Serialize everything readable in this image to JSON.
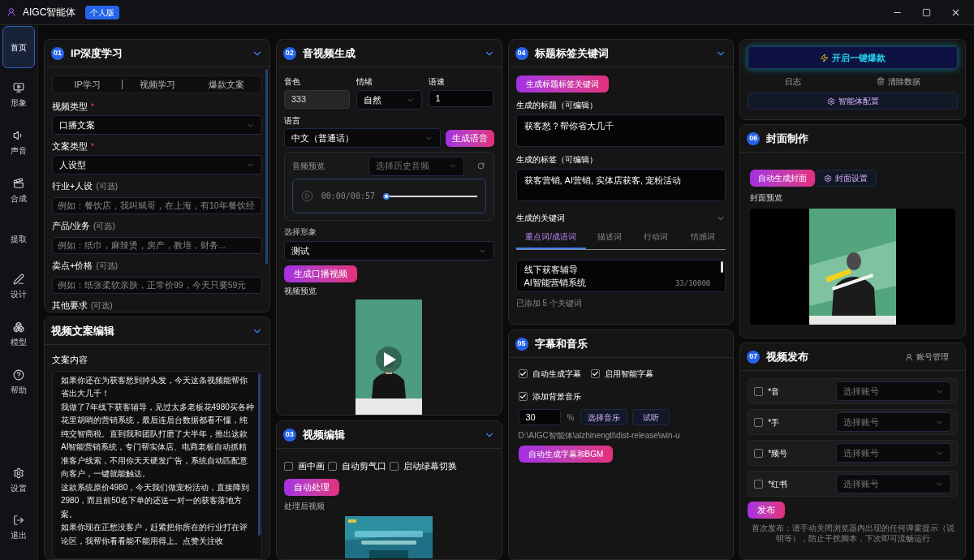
{
  "app": {
    "title": "AIGC智能体",
    "badge": "个人版"
  },
  "sidebar": {
    "items": [
      {
        "label": "首页",
        "selected": true
      },
      {
        "label": "形象",
        "selected": false
      },
      {
        "label": "声音",
        "selected": false
      },
      {
        "label": "合成",
        "selected": false
      },
      {
        "label": "提取",
        "selected": false
      },
      {
        "label": "设计",
        "selected": false
      },
      {
        "label": "模型",
        "selected": false
      },
      {
        "label": "帮助",
        "selected": false
      }
    ],
    "bottom_items": [
      {
        "label": "设置"
      },
      {
        "label": "退出"
      }
    ]
  },
  "ip_learning": {
    "number": "01",
    "title": "IP深度学习",
    "tabs": [
      "IP学习",
      "视频学习",
      "爆款文案"
    ],
    "fields": [
      {
        "label": "视频类型",
        "required_mark": "*",
        "kind": "select",
        "value": "口播文案"
      },
      {
        "label": "文案类型",
        "required_mark": "*",
        "kind": "select",
        "value": "人设型"
      },
      {
        "label": "行业+人设",
        "optional": "(可选)",
        "kind": "input",
        "placeholder": "例如：餐饮店，我叫斌哥，在上海，有10年餐饮经"
      },
      {
        "label": "产品/业务",
        "optional": "(可选)",
        "kind": "input",
        "placeholder": "例如：纸巾，麻辣烫，房产，教培，财务..."
      },
      {
        "label": "卖点+价格",
        "optional": "(可选)",
        "kind": "input",
        "placeholder": "例如：纸张柔软亲肤，正常价99，今天只要59元"
      },
      {
        "label": "其他要求",
        "optional": "(可选)",
        "kind": "label"
      }
    ]
  },
  "script_editor": {
    "title": "视频文案编辑",
    "label": "文案内容",
    "paragraphs": [
      "如果你还在为获客愁到掉头发，今天这条视频能帮你省出大几千！",
      "我做了7年线下获客辅导，见过太多老板花4980买各种花里胡哨的营销系统，最后连后台数据都看不懂，纯纯交智商税。直到我和团队打磨了大半年，推出这款AI智能营销系统，专门帮实体店、电商老板自动抓精准客户线索，不用你天天硬发广告，系统自动匹配意向客户，一键就能触达。",
      "这款系统原价4980，今天我们做宠粉活动，直接降到2980，而且前50名下单的还送一对一的获客落地方案。",
      "如果你现在正愁没客户，赶紧把你所在的行业打在评论区，我帮你看看能不能用得上。点赞关注收"
    ]
  },
  "av_generation": {
    "number": "02",
    "title": "音视频生成",
    "voice": {
      "label": "音色",
      "value": "333"
    },
    "emotion": {
      "label": "情绪",
      "value": "自然"
    },
    "speed": {
      "label": "语速",
      "value": "1"
    },
    "language": {
      "label": "语言",
      "value": "中文（普通话）"
    },
    "generate_voice": "生成语音",
    "audio_preview": {
      "label": "音频预览",
      "history_placeholder": "选择历史音频",
      "time": "00:00/00:57",
      "level": 0
    },
    "avatar": {
      "label": "选择形象",
      "value": "测试"
    },
    "generate_video": "生成口播视频",
    "video_preview_label": "视频预览"
  },
  "video_edit": {
    "number": "03",
    "title": "视频编辑",
    "options": [
      {
        "label": "画中画",
        "checked": false
      },
      {
        "label": "自动剪气口",
        "checked": false
      },
      {
        "label": "启动绿幕切换",
        "checked": false
      }
    ],
    "button": "自动处理",
    "output_label": "处理后视频"
  },
  "titles": {
    "number": "04",
    "title": "标题标签关键词",
    "button": "生成标题标签关键词",
    "title_field": {
      "label": "生成的标题（可编辑）",
      "value": "获客愁？帮你省大几千"
    },
    "tags_field": {
      "label": "生成的标签（可编辑）",
      "value": "获客营销, AI营销, 实体店获客, 宠粉活动"
    },
    "keywords": {
      "label": "生成的关键词",
      "tabs": [
        {
          "label": "重点词/成语词",
          "selected": true
        },
        {
          "label": "描述词",
          "selected": false
        },
        {
          "label": "行动词",
          "selected": false
        },
        {
          "label": "情感词",
          "selected": false
        }
      ],
      "lines": [
        "线下获客辅导",
        "AI智能营销系统"
      ],
      "counter": "33/10000",
      "summary": "已添加 5 个关键词"
    }
  },
  "subtitles": {
    "number": "05",
    "title": "字幕和音乐",
    "options": [
      {
        "label": "自动生成字幕",
        "checked": true
      },
      {
        "label": "启用智能字幕",
        "checked": true
      },
      {
        "label": "添加背景音乐",
        "checked": true
      }
    ],
    "volume": "30",
    "unit": "%",
    "select_music": "选择音乐",
    "listen": "试听",
    "path": "D:\\AIGC智能体\\alzhinengti\\dist-release\\win-u",
    "button": "自动生成字幕和BGM"
  },
  "actions": {
    "launch": "开启一键爆款",
    "log": "日志",
    "clear": "清除数据",
    "config": "智能体配置"
  },
  "cover": {
    "number": "06",
    "title": "封面制作",
    "auto": "自动生成封面",
    "settings": "封面设置",
    "preview_label": "封面预览"
  },
  "publish": {
    "number": "07",
    "title": "视频发布",
    "account_manage": "账号管理",
    "platforms": [
      {
        "label": "*音",
        "checked": false,
        "placeholder": "选择账号"
      },
      {
        "label": "*手",
        "checked": false,
        "placeholder": "选择账号"
      },
      {
        "label": "*频号",
        "checked": false,
        "placeholder": "选择账号"
      },
      {
        "label": "*红书",
        "checked": false,
        "placeholder": "选择账号"
      }
    ],
    "button": "发布",
    "note": "首次发布：请手动关闭浏览器内出现的任何弹窗提示（说明等），防止干扰脚本，下次即可流畅运行"
  }
}
